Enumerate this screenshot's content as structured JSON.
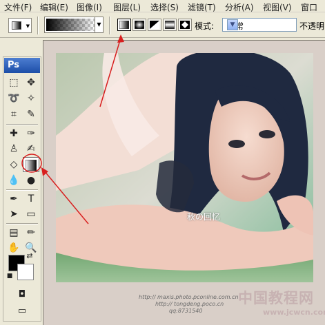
{
  "menubar": {
    "items": [
      "文件(F)",
      "编辑(E)",
      "图像(I)",
      "图层(L)",
      "选择(S)",
      "滤镜(T)",
      "分析(A)",
      "视图(V)",
      "窗口"
    ]
  },
  "options_bar": {
    "tool_preset_icon": "gradient-tool-icon",
    "gradient_types": [
      {
        "name": "linear",
        "selected": true
      },
      {
        "name": "radial",
        "selected": false
      },
      {
        "name": "angle",
        "selected": false
      },
      {
        "name": "reflected",
        "selected": false
      },
      {
        "name": "diamond",
        "selected": false
      }
    ],
    "mode_label": "模式:",
    "mode_value": "正常",
    "opacity_label": "不透明"
  },
  "toolbox": {
    "logo": "Ps",
    "selected_tool": "gradient-tool",
    "foreground_color": "#000000",
    "background_color": "#ffffff"
  },
  "document": {
    "caption": "秋の回忆",
    "credits": [
      "http:// maxis.photo.pconline.com.cn",
      "http:// tongdeng.poco.cn",
      "qq:8731540"
    ],
    "watermark_cn": "中国教程网",
    "watermark_url": "www.jcwcn.com"
  },
  "annotations": {
    "arrow_color": "#d81e1e"
  }
}
